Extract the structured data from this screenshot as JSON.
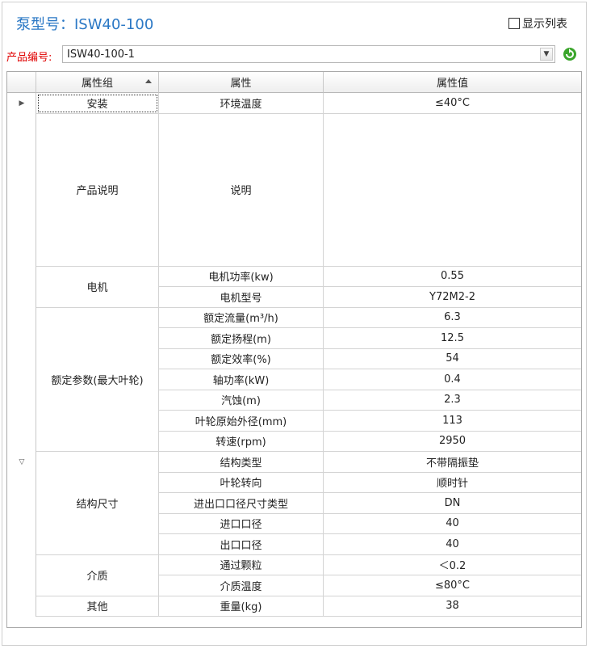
{
  "header": {
    "title": "泵型号：ISW40-100",
    "show_list_label": "显示列表",
    "show_list_checked": false
  },
  "product": {
    "label": "产品编号:",
    "value": "ISW40-100-1"
  },
  "icons": {
    "dropdown": "chevron-down-icon",
    "refresh": "refresh-icon",
    "sort": "sort-ascending-icon",
    "current_row": "row-pointer-icon",
    "new_row": "row-add-icon"
  },
  "colors": {
    "title": "#2b78c5",
    "product_label": "#e00000",
    "refresh_icon": "#3aa52b"
  },
  "grid": {
    "columns": [
      "属性组",
      "属性",
      "属性值"
    ],
    "groups": [
      {
        "name": "安装",
        "rows": [
          {
            "property": "环境温度",
            "value": "≤40°C"
          }
        ]
      },
      {
        "name": "产品说明",
        "rows": [
          {
            "property": "说明",
            "value": ""
          }
        ]
      },
      {
        "name": "电机",
        "rows": [
          {
            "property": "电机功率(kw)",
            "value": "0.55"
          },
          {
            "property": "电机型号",
            "value": "Y72M2-2"
          }
        ]
      },
      {
        "name": "额定参数(最大叶轮)",
        "rows": [
          {
            "property": "额定流量(m³/h)",
            "value": "6.3"
          },
          {
            "property": "额定扬程(m)",
            "value": "12.5"
          },
          {
            "property": "额定效率(%)",
            "value": "54"
          },
          {
            "property": "轴功率(kW)",
            "value": "0.4"
          },
          {
            "property": "汽蚀(m)",
            "value": "2.3"
          },
          {
            "property": "叶轮原始外径(mm)",
            "value": "113"
          },
          {
            "property": "转速(rpm)",
            "value": "2950"
          }
        ]
      },
      {
        "name": "结构尺寸",
        "rows": [
          {
            "property": "结构类型",
            "value": "不带隔振垫"
          },
          {
            "property": "叶轮转向",
            "value": "顺时针"
          },
          {
            "property": "进出口口径尺寸类型",
            "value": "DN"
          },
          {
            "property": "进口口径",
            "value": "40"
          },
          {
            "property": "出口口径",
            "value": "40"
          }
        ]
      },
      {
        "name": "介质",
        "rows": [
          {
            "property": "通过颗粒",
            "value": "＜0.2"
          },
          {
            "property": "介质温度",
            "value": "≤80°C"
          }
        ]
      },
      {
        "name": "其他",
        "rows": [
          {
            "property": "重量(kg)",
            "value": "38"
          }
        ]
      }
    ]
  }
}
